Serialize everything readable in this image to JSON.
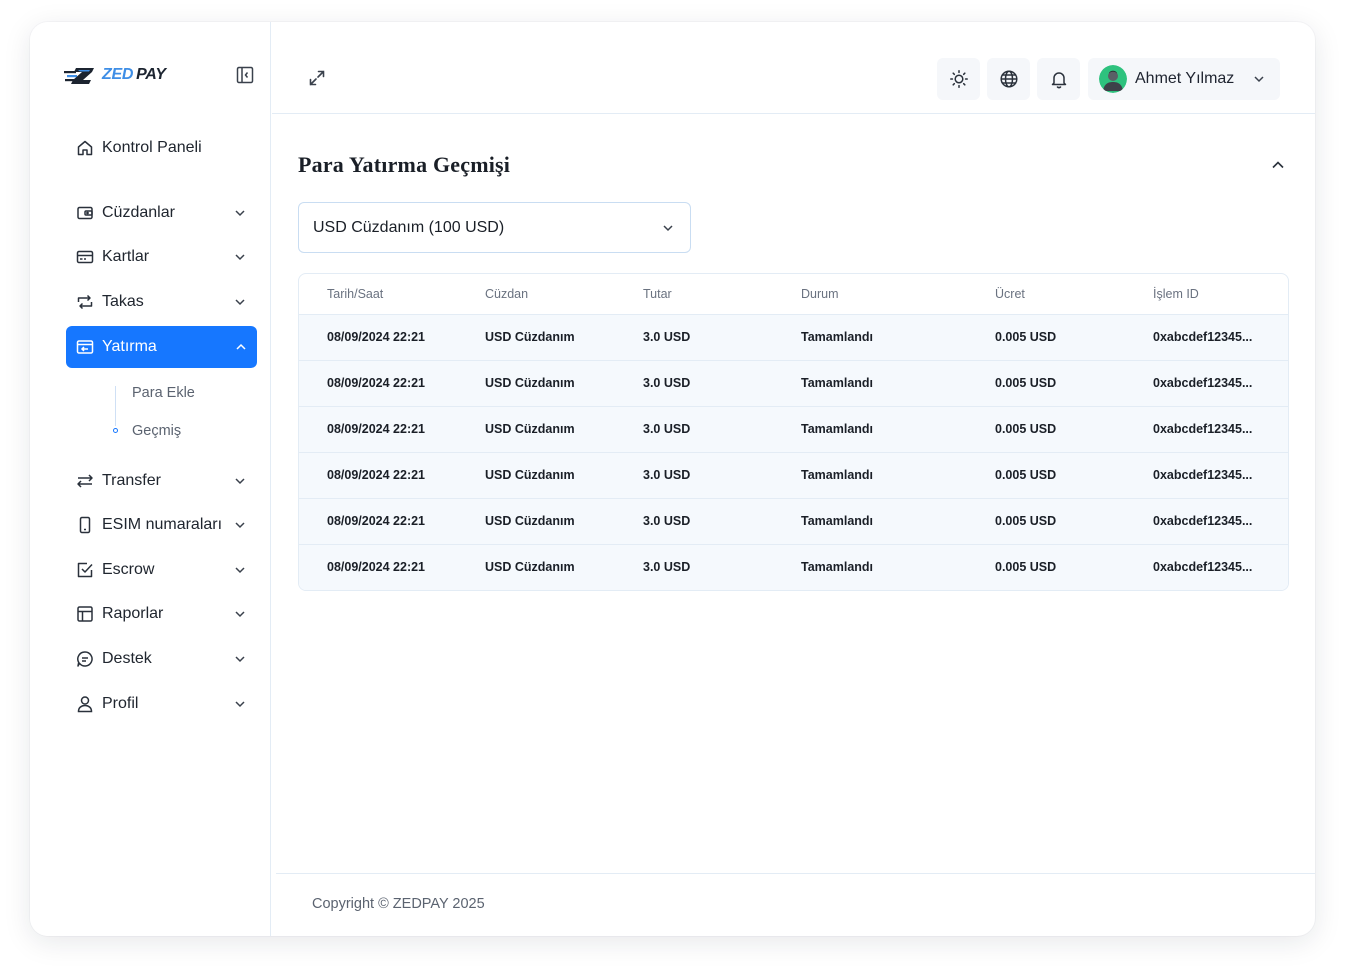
{
  "brand": {
    "logo_zed": "ZED",
    "logo_pay": "PAY",
    "accent": "#1677ff",
    "logo_blue": "#3e8ee6"
  },
  "sidebar": {
    "items": [
      {
        "label": "Kontrol Paneli",
        "icon": "home-icon",
        "has_chevron": false
      },
      {
        "label": "Cüzdanlar",
        "icon": "wallet-icon",
        "has_chevron": true
      },
      {
        "label": "Kartlar",
        "icon": "card-icon",
        "has_chevron": true
      },
      {
        "label": "Takas",
        "icon": "exchange-icon",
        "has_chevron": true
      },
      {
        "label": "Yatırma",
        "icon": "deposit-icon",
        "has_chevron": true,
        "active": true
      },
      {
        "label": "Transfer",
        "icon": "transfer-arrows-icon",
        "has_chevron": true
      },
      {
        "label": "ESIM numaraları",
        "icon": "phone-icon",
        "has_chevron": true
      },
      {
        "label": "Escrow",
        "icon": "checkbox-icon",
        "has_chevron": true
      },
      {
        "label": "Raporlar",
        "icon": "table-icon",
        "has_chevron": true
      },
      {
        "label": "Destek",
        "icon": "chat-icon",
        "has_chevron": true
      },
      {
        "label": "Profil",
        "icon": "user-icon",
        "has_chevron": true
      }
    ],
    "sub_items": [
      {
        "label": "Para Ekle",
        "active": false
      },
      {
        "label": "Geçmiş",
        "active": true
      }
    ]
  },
  "topbar": {
    "user_name": "Ahmet Yılmaz",
    "icons": [
      "sun-icon",
      "globe-icon",
      "bell-icon"
    ]
  },
  "main": {
    "title": "Para Yatırma Geçmişi",
    "wallet_select": {
      "value": "USD Cüzdanım (100 USD)"
    },
    "table": {
      "columns": [
        "Tarih/Saat",
        "Cüzdan",
        "Tutar",
        "Durum",
        "Ücret",
        "İşlem ID"
      ],
      "rows": [
        [
          "08/09/2024 22:21",
          "USD Cüzdanım",
          "3.0 USD",
          "Tamamlandı",
          "0.005 USD",
          "0xabcdef12345..."
        ],
        [
          "08/09/2024 22:21",
          "USD Cüzdanım",
          "3.0 USD",
          "Tamamlandı",
          "0.005 USD",
          "0xabcdef12345..."
        ],
        [
          "08/09/2024 22:21",
          "USD Cüzdanım",
          "3.0 USD",
          "Tamamlandı",
          "0.005 USD",
          "0xabcdef12345..."
        ],
        [
          "08/09/2024 22:21",
          "USD Cüzdanım",
          "3.0 USD",
          "Tamamlandı",
          "0.005 USD",
          "0xabcdef12345..."
        ],
        [
          "08/09/2024 22:21",
          "USD Cüzdanım",
          "3.0 USD",
          "Tamamlandı",
          "0.005 USD",
          "0xabcdef12345..."
        ],
        [
          "08/09/2024 22:21",
          "USD Cüzdanım",
          "3.0 USD",
          "Tamamlandı",
          "0.005 USD",
          "0xabcdef12345..."
        ]
      ]
    }
  },
  "footer": {
    "copyright": "Copyright © ZEDPAY 2025"
  }
}
